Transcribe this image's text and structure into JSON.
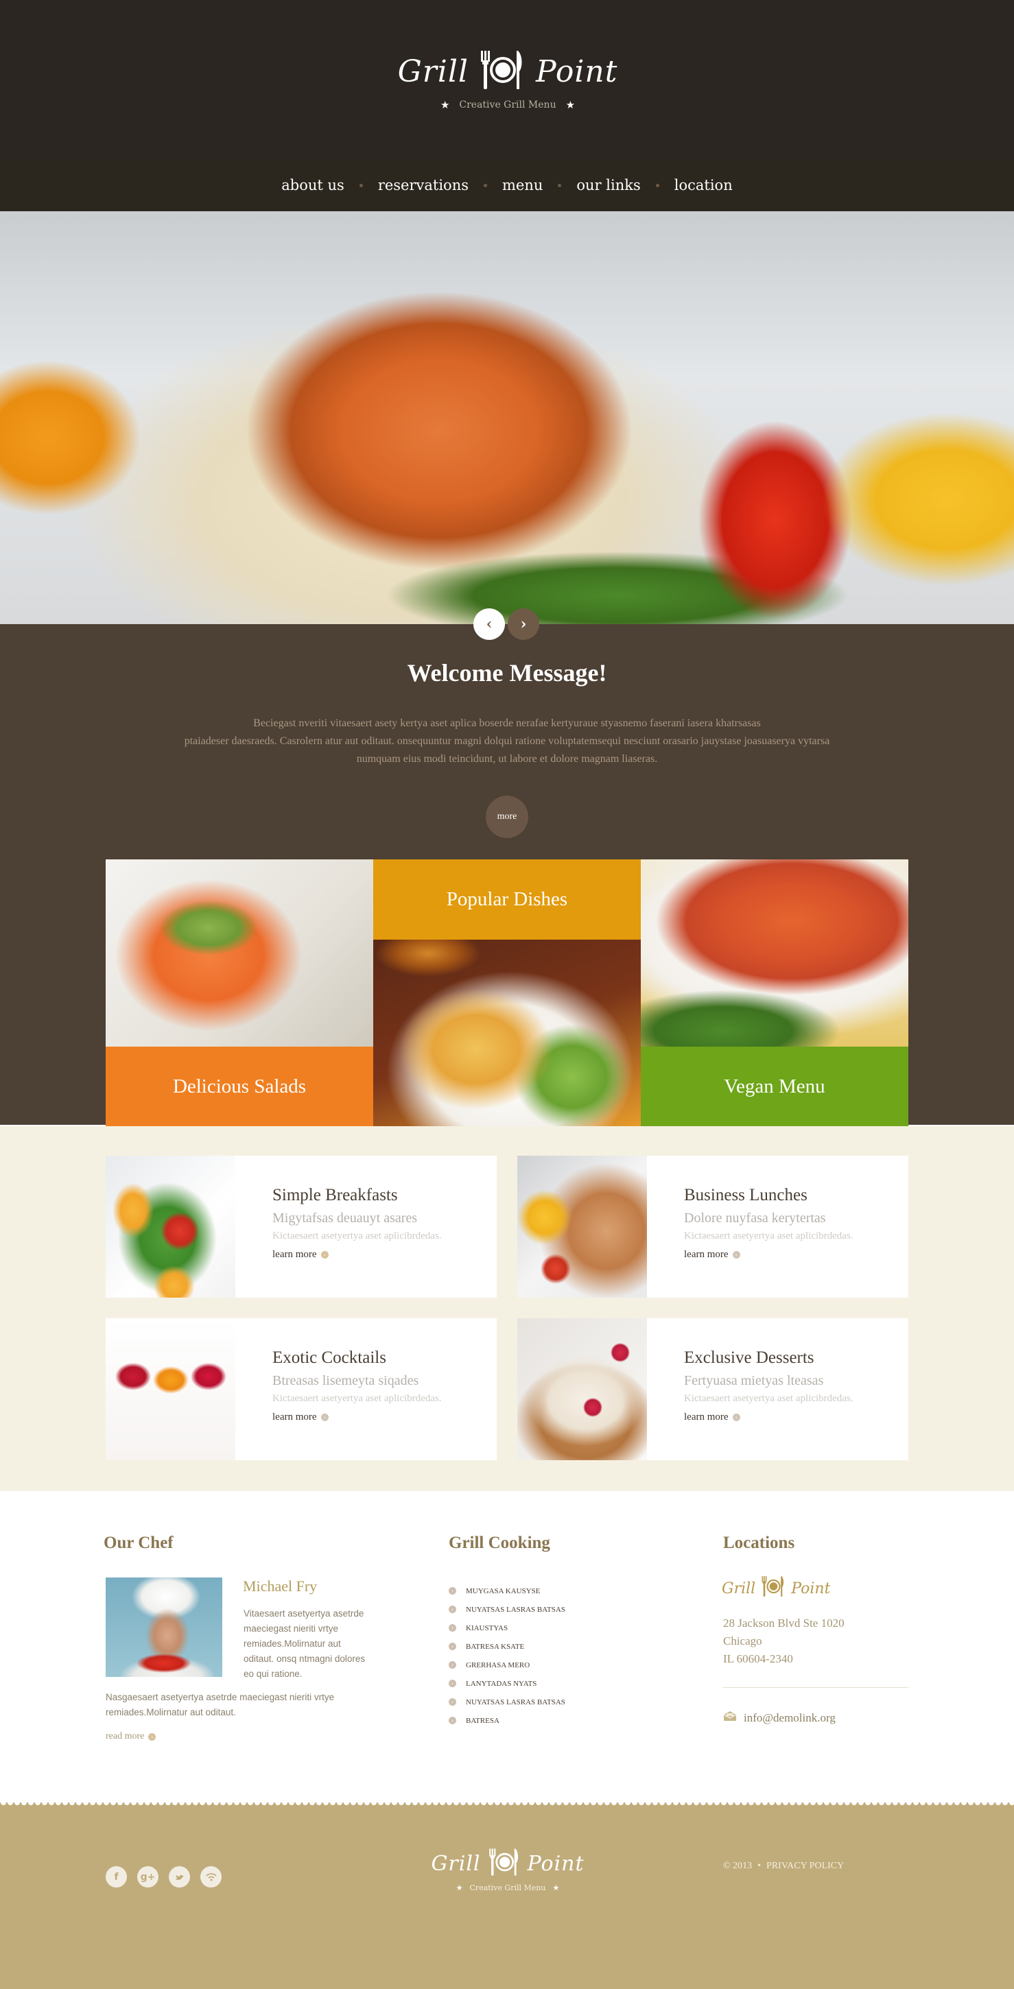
{
  "brand": {
    "word_left": "Grill",
    "word_right": "Point",
    "tagline": "Creative Grill Menu",
    "icon": "plate-fork-knife-icon"
  },
  "nav": {
    "items": [
      {
        "label": "about us"
      },
      {
        "label": "reservations"
      },
      {
        "label": "menu"
      },
      {
        "label": "our links"
      },
      {
        "label": "location"
      }
    ]
  },
  "slider": {
    "prev_icon": "chevron-left-icon",
    "next_icon": "chevron-right-icon",
    "prev_glyph": "‹",
    "next_glyph": "›"
  },
  "welcome": {
    "title": "Welcome Message!",
    "text_line1": "Beciegast nveriti vitaesaert asety kertya aset aplica boserde nerafae kertyuraue styasnemo faserani  iasera khatrsasas",
    "text_line2": "ptaiadeser daesraeds. Casrolern atur aut oditaut. onsequuntur magni dolqui ratione voluptatemsequi nesciunt orasario jauystase joasuaserya vytarsa",
    "text_line3": "numquam eius modi teincidunt, ut labore et dolore magnam liaseras.",
    "more_label": "more"
  },
  "tiles": [
    {
      "label": "Delicious Salads",
      "color": "#f07f21"
    },
    {
      "label": "Popular Dishes",
      "color": "#e29b0d"
    },
    {
      "label": "Vegan Menu",
      "color": "#6ea519"
    }
  ],
  "features": {
    "learn_more_label": "learn more",
    "cards": [
      {
        "title": "Simple Breakfasts",
        "subtitle": "Migytafsas deuauyt asares",
        "desc": "Kictaesaert asetyertya aset aplicibrdedas."
      },
      {
        "title": "Business Lunches",
        "subtitle": "Dolore nuyfasa kerytertas",
        "desc": "Kictaesaert asetyertya aset aplicibrdedas."
      },
      {
        "title": "Exotic Cocktails",
        "subtitle": "Btreasas lisemeyta siqades",
        "desc": "Kictaesaert asetyertya aset aplicibrdedas."
      },
      {
        "title": "Exclusive Desserts",
        "subtitle": "Fertyuasa mietyas lteasas",
        "desc": "Kictaesaert asetyertya aset aplicibrdedas."
      }
    ]
  },
  "chef": {
    "heading": "Our Chef",
    "name": "Michael Fry",
    "bio": "Vitaesaert asetyertya asetrde maeciegast nieriti vrtye remiades.Molirnatur aut oditaut. onsq ntmagni dolores eo qui ratione.",
    "extra": "Nasgaesaert asetyertya asetrde maeciegast nieriti vrtye remiades.Molirnatur aut oditaut.",
    "read_more": "read more"
  },
  "grill_cooking": {
    "heading": "Grill Cooking",
    "items": [
      "MUYGASA KAUSYSE",
      "NUYATSAS LASRAS BATSAS",
      "KIAUSTYAS",
      "BATRESA KSATE",
      "GRERHASA MERO",
      "LANYTADAS NYATS",
      "NUYATSAS LASRAS BATSAS",
      "BATRESA"
    ]
  },
  "locations": {
    "heading": "Locations",
    "address_line1": "28 Jackson Blvd Ste 1020",
    "address_line2": "Chicago",
    "address_line3": "IL 60604-2340",
    "email": "info@demolink.org",
    "email_icon": "envelope-icon"
  },
  "footer": {
    "socials": [
      {
        "name": "facebook",
        "glyph": "f"
      },
      {
        "name": "google-plus",
        "glyph": "g+"
      },
      {
        "name": "twitter",
        "glyph": "🐦"
      },
      {
        "name": "rss",
        "glyph": "◠"
      }
    ],
    "copyright": "© 2013",
    "separator": "•",
    "privacy": "PRIVACY POLICY"
  }
}
